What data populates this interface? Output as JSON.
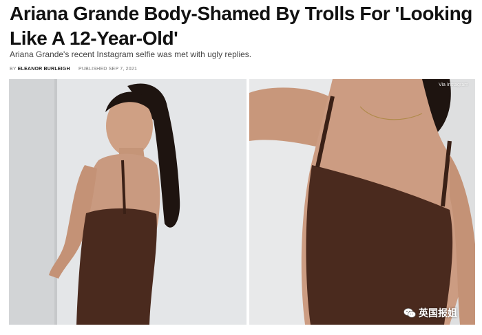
{
  "article": {
    "headline": "Ariana Grande Body-Shamed By Trolls For 'Looking Like A 12-Year-Old'",
    "dek": "Ariana Grande's recent Instagram selfie was met with ugly replies.",
    "byline": {
      "by_label": "BY",
      "author": "ELEANOR BURLEIGH",
      "published_label": "PUBLISHED",
      "date": "SEP 7, 2021"
    },
    "image": {
      "credit": "Via Instagram"
    },
    "watermark": {
      "text": "英国报姐",
      "icon": "wechat-icon"
    }
  },
  "colors": {
    "dress": "#4a2a1e",
    "wall": "#dcdedf",
    "skin": "#c99a80",
    "hair": "#1e1410"
  }
}
